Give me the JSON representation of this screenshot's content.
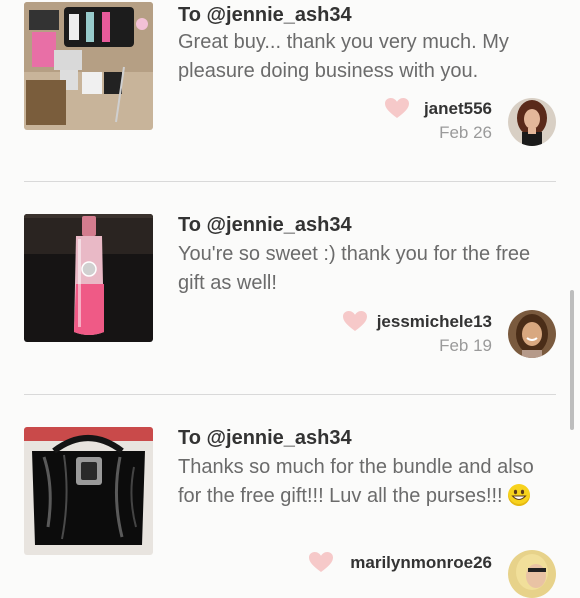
{
  "feed": {
    "items": [
      {
        "recipient": "To @jennie_ash34",
        "message": "Great buy... thank you very much. My pleasure doing business with you.",
        "username": "janet556",
        "date": "Feb 26",
        "thumb_icon": "photo-of-jewelry-and-watches",
        "avatar_icon": "woman-dark-hair-avatar"
      },
      {
        "recipient": "To @jennie_ash34",
        "message": "You're so sweet :) thank you for the free gift as well!",
        "username": "jessmichele13",
        "date": "Feb 19",
        "thumb_icon": "photo-of-pink-perfume-bottle",
        "avatar_icon": "woman-smiling-avatar"
      },
      {
        "recipient": "To @jennie_ash34",
        "message": "Thanks so much for the bundle and also for the free gift!!! Luv all the purses!!!",
        "emoji": "grinning-face-emoji",
        "username": "marilynmonroe26",
        "date": "",
        "thumb_icon": "photo-of-black-patent-purse",
        "avatar_icon": "woman-blonde-avatar"
      }
    ]
  },
  "colors": {
    "heart": "#f6c9c9",
    "divider": "#d9d9d9",
    "recipient": "#333333",
    "message": "#6b6b6b",
    "date": "#9a9a9a"
  }
}
